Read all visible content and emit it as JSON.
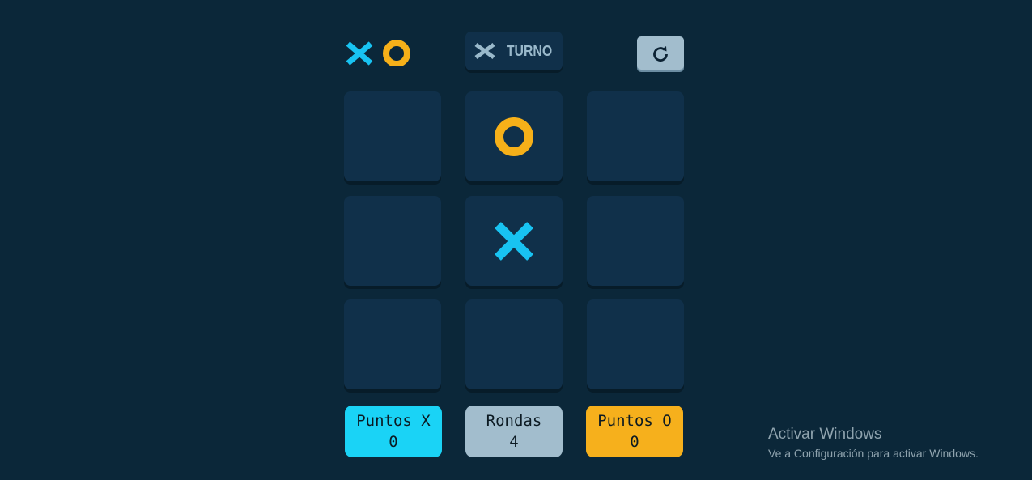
{
  "header": {
    "logo_icons": [
      "x-mark-icon",
      "o-mark-icon"
    ],
    "turn_label": "TURNO",
    "turn_player": "X",
    "restart_icon": "restart-icon"
  },
  "board": {
    "cells": [
      "",
      "O",
      "",
      "",
      "X",
      "",
      "",
      "",
      ""
    ]
  },
  "scores": {
    "x_label": "Puntos X",
    "x_value": "0",
    "rounds_label": "Rondas",
    "rounds_value": "4",
    "o_label": "Puntos O",
    "o_value": "0"
  },
  "watermark": {
    "title": "Activar Windows",
    "subtitle": "Ve a Configuración para activar Windows."
  },
  "colors": {
    "background": "#0b2739",
    "cell": "#10304a",
    "x_color": "#18c3f2",
    "o_color": "#f6b019",
    "silver": "#a2bdcd",
    "x_score_bg": "#1ad3f6",
    "o_score_bg": "#f6b01c"
  }
}
